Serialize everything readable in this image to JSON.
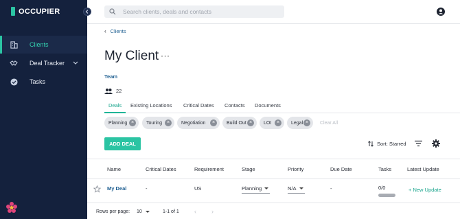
{
  "brand": {
    "name": "OCCUPIER"
  },
  "sidebar": {
    "items": [
      {
        "label": "Clients",
        "icon": "building-icon",
        "active": true
      },
      {
        "label": "Deal Tracker",
        "icon": "handshake-icon",
        "active": false
      },
      {
        "label": "Tasks",
        "icon": "check-circle-icon",
        "active": false
      }
    ]
  },
  "search": {
    "placeholder": "Search clients, deals and contacts",
    "value": ""
  },
  "breadcrumb": {
    "label": "Clients"
  },
  "page": {
    "title": "My Client",
    "more": "···"
  },
  "team": {
    "label": "Team",
    "count": "22"
  },
  "tabs": [
    {
      "label": "Deals",
      "active": true
    },
    {
      "label": "Existing Locations"
    },
    {
      "label": "Critical Dates"
    },
    {
      "label": "Contacts"
    },
    {
      "label": "Documents"
    }
  ],
  "filters": {
    "chips": [
      "Planning",
      "Touring",
      "Negotiation",
      "Build Out",
      "LOI",
      "Legal"
    ],
    "clear_all": "Clear All"
  },
  "toolbar": {
    "add_label": "ADD DEAL",
    "sort_label": "Sort: Starred"
  },
  "table": {
    "headers": [
      "Name",
      "Critical Dates",
      "Requirement",
      "Stage",
      "Priority",
      "Due Date",
      "Tasks",
      "Latest Update"
    ],
    "rows": [
      {
        "name": "My Deal",
        "critical_dates": "-",
        "requirement": "US",
        "stage": "Planning",
        "priority": "N/A",
        "due_date": "-",
        "tasks": "0/0",
        "tasks_progress": 0,
        "latest_update": "+ New Update"
      }
    ]
  },
  "pagination": {
    "rows_per_page_label": "Rows per page:",
    "rows_per_page": "10",
    "range": "1-1 of 1"
  },
  "colors": {
    "accent": "#2bc4a3",
    "sidebar": "#14213d",
    "link": "#1f5f91"
  }
}
